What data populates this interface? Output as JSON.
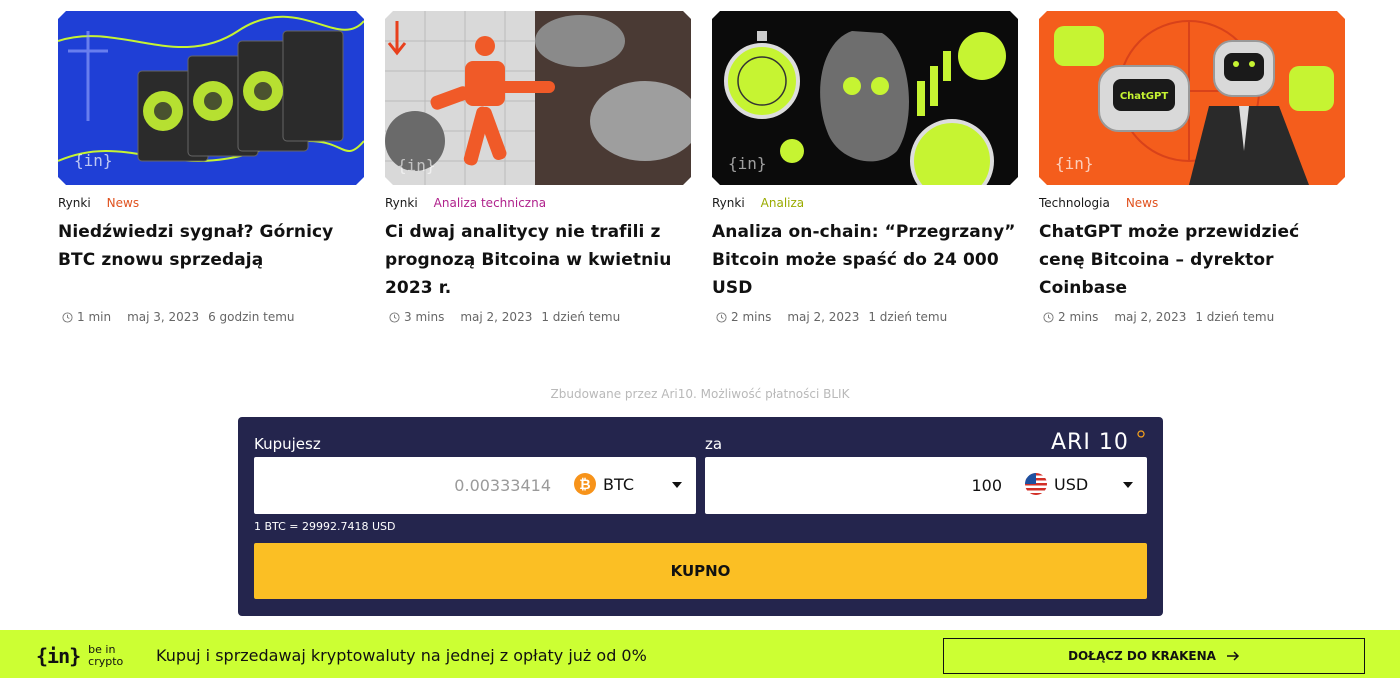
{
  "articles": [
    {
      "category": "Rynki",
      "tag": "News",
      "tag_color": "#e0521f",
      "title": "Niedźwiedzi sygnał? Górnicy BTC znowu sprzedają",
      "read_time": "1 min",
      "date": "maj 3, 2023",
      "ago": "6 godzin temu"
    },
    {
      "category": "Rynki",
      "tag": "Analiza techniczna",
      "tag_color": "#b0228c",
      "title": "Ci dwaj analitycy nie trafili z prognozą Bitcoina w kwietniu 2023 r.",
      "read_time": "3 mins",
      "date": "maj 2, 2023",
      "ago": "1 dzień temu"
    },
    {
      "category": "Rynki",
      "tag": "Analiza",
      "tag_color": "#9aab00",
      "title": "Analiza on-chain: “Przegrzany” Bitcoin może spaść do 24 000 USD",
      "read_time": "2 mins",
      "date": "maj 2, 2023",
      "ago": "1 dzień temu"
    },
    {
      "category": "Technologia",
      "tag": "News",
      "tag_color": "#e0521f",
      "title": "ChatGPT może przewidzieć cenę Bitcoina – dyrektor Coinbase",
      "read_time": "2 mins",
      "date": "maj 2, 2023",
      "ago": "1 dzień temu"
    }
  ],
  "thumb_texts": {
    "chatgpt": "ChatGPT"
  },
  "widget": {
    "built_by": "Zbudowane przez Ari10. Możliwość płatności BLIK",
    "brand": "ARI 10",
    "buy_label": "Kupujesz",
    "for_label": "za",
    "crypto_amount": "0.00333414",
    "crypto_currency": "BTC",
    "fiat_amount": "100",
    "fiat_currency": "USD",
    "rate": "1 BTC = 29992.7418 USD",
    "buy_button": "KUPNO"
  },
  "banner": {
    "logo_words_1": "be in",
    "logo_words_2": "crypto",
    "promo": "Kupuj i sprzedawaj kryptowaluty na jednej z opłaty już od 0%",
    "cta": "DOŁĄCZ DO KRAKENA"
  },
  "colors": {
    "widget_bg": "#24254d",
    "buy_button": "#fbbf24",
    "banner_bg": "#ccff33",
    "bitcoin": "#f7931a",
    "lime": "#c6f432"
  },
  "icons": [
    "clock-icon",
    "bitcoin-icon",
    "us-flag-icon",
    "chevron-down-icon",
    "arrow-right-icon"
  ]
}
